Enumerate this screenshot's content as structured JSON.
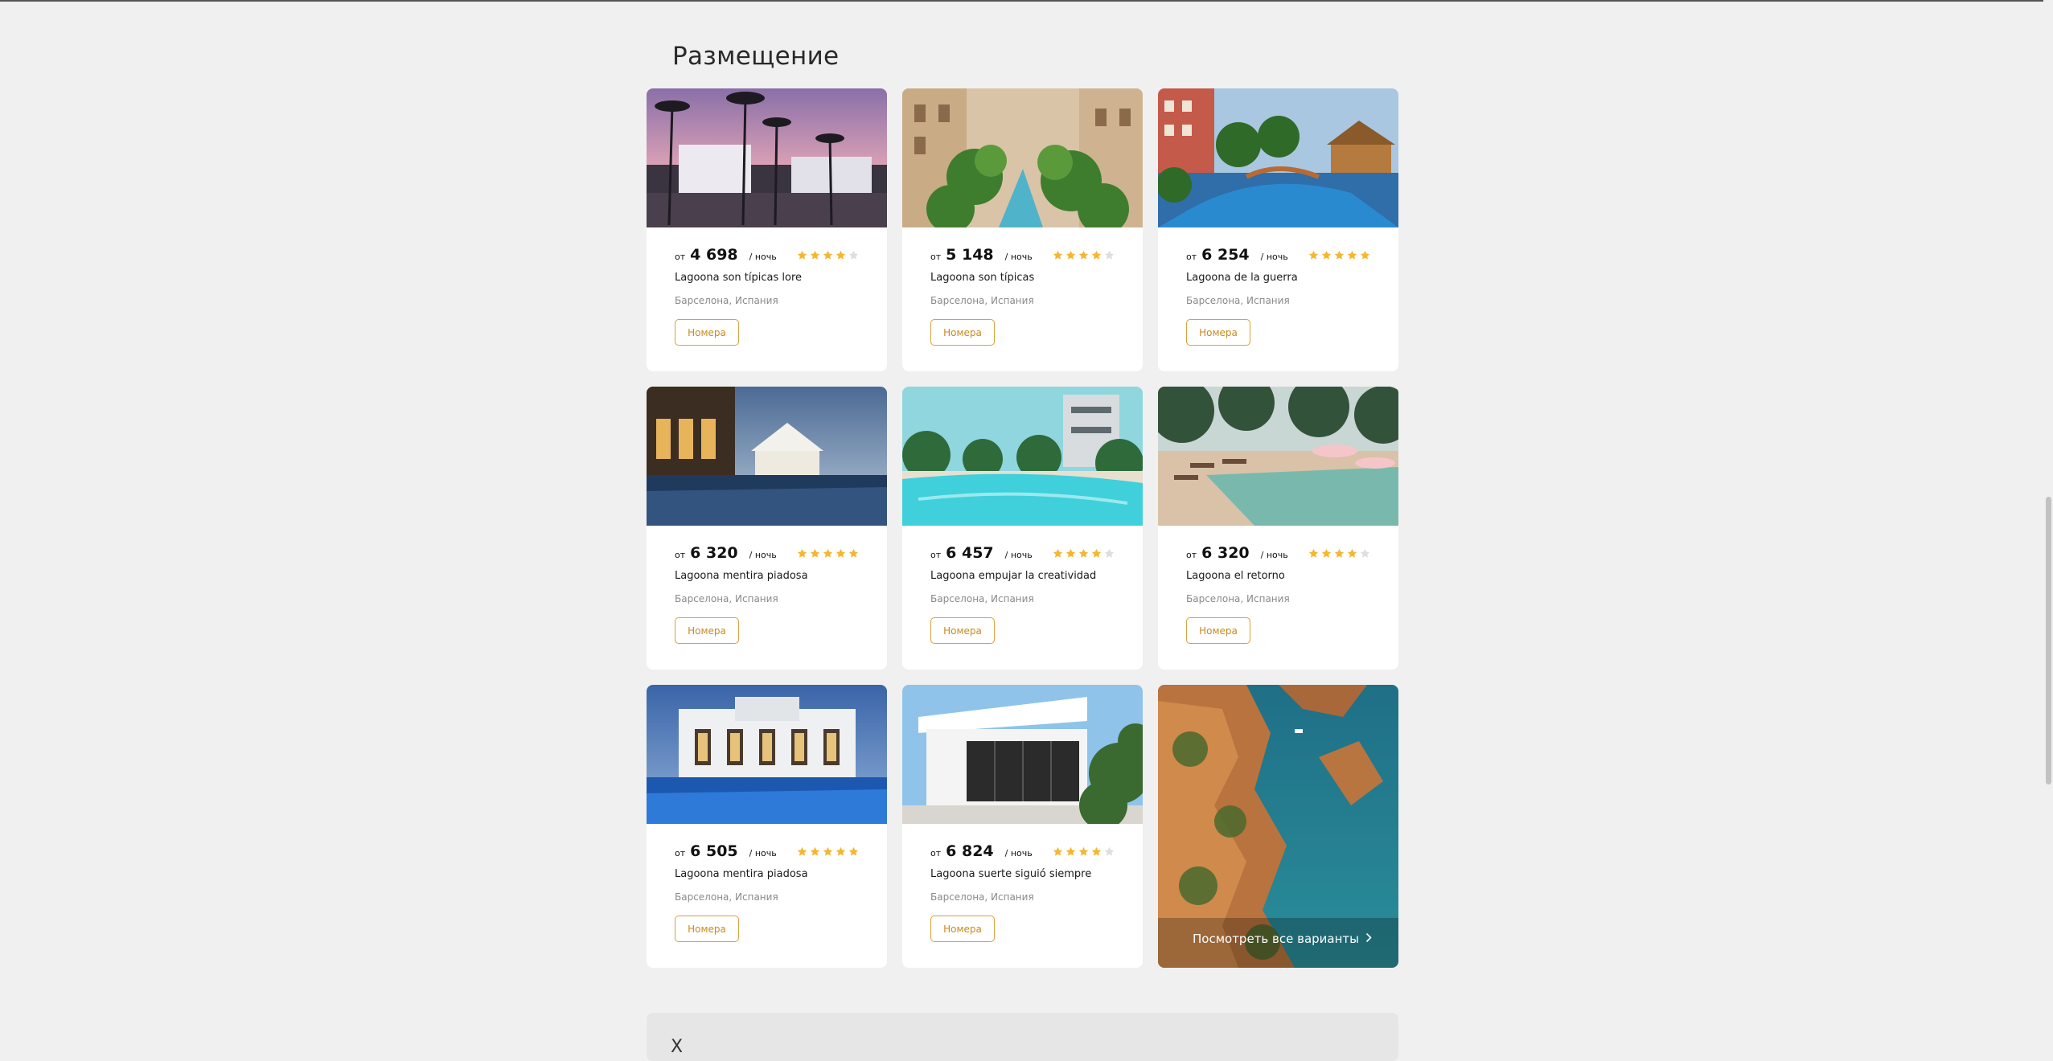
{
  "section": {
    "title": "Размещение"
  },
  "price_prefix": "от",
  "price_unit": "/ ночь",
  "button_label": "Номера",
  "colors": {
    "star_on": "#f5b731",
    "star_off": "#dedede",
    "accent": "#d9a140"
  },
  "hotels": [
    {
      "price": "4 698",
      "name": "Lagoona son típicas lore",
      "location": "Барселона, Испания",
      "rating": 4
    },
    {
      "price": "5 148",
      "name": "Lagoona son típicas",
      "location": "Барселона, Испания",
      "rating": 4
    },
    {
      "price": "6 254",
      "name": "Lagoona de la guerra",
      "location": "Барселона, Испания",
      "rating": 5
    },
    {
      "price": "6 320",
      "name": "Lagoona mentira piadosa",
      "location": "Барселона, Испания",
      "rating": 5
    },
    {
      "price": "6 457",
      "name": "Lagoona empujar la creatividad",
      "location": "Барселона, Испания",
      "rating": 4
    },
    {
      "price": "6 320",
      "name": "Lagoona el retorno",
      "location": "Барселона, Испания",
      "rating": 4
    },
    {
      "price": "6 505",
      "name": "Lagoona mentira piadosa",
      "location": "Барселона, Испания",
      "rating": 5
    },
    {
      "price": "6 824",
      "name": "Lagoona suerte siguió siempre",
      "location": "Барселона, Испания",
      "rating": 4
    }
  ],
  "promo": {
    "link_label": "Посмотреть все варианты",
    "icon": "chevron-right-icon"
  },
  "next_section": {
    "glyph": "Х"
  }
}
